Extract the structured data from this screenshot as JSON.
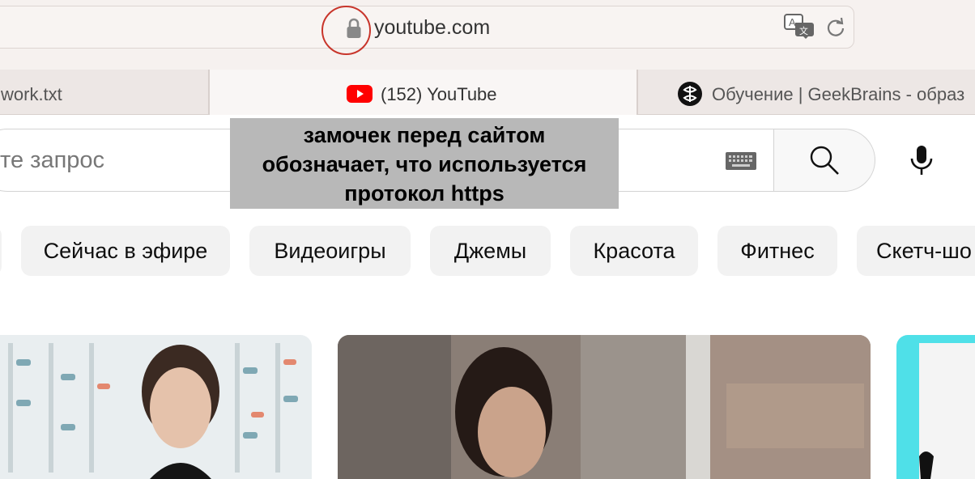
{
  "browser": {
    "url": "youtube.com",
    "icons": {
      "lock": "lock-icon",
      "translate": "translate-icon",
      "reload": "reload-icon"
    }
  },
  "tabs": [
    {
      "label": "work.txt",
      "active": false
    },
    {
      "label": "(152) YouTube",
      "active": true,
      "icon": "youtube-logo-icon"
    },
    {
      "label": "Обучение | GeekBrains - образ",
      "active": false,
      "icon": "geekbrains-logo-icon"
    }
  ],
  "search": {
    "placeholder": "те запрос",
    "icons": {
      "keyboard": "keyboard-icon",
      "search": "search-icon",
      "mic": "mic-icon"
    }
  },
  "annotation": {
    "lines": [
      "замочек перед сайтом",
      "обозначает, что используется",
      "протокол https"
    ]
  },
  "chips": [
    "Сейчас в эфире",
    "Видеоигры",
    "Джемы",
    "Красота",
    "Фитнес",
    "Скетч-шо"
  ],
  "colors": {
    "youtube_red": "#ff0000",
    "highlight_circle": "#c8352b",
    "annotation_bg": "#b8b8b8",
    "chip_bg": "#f2f2f2"
  }
}
